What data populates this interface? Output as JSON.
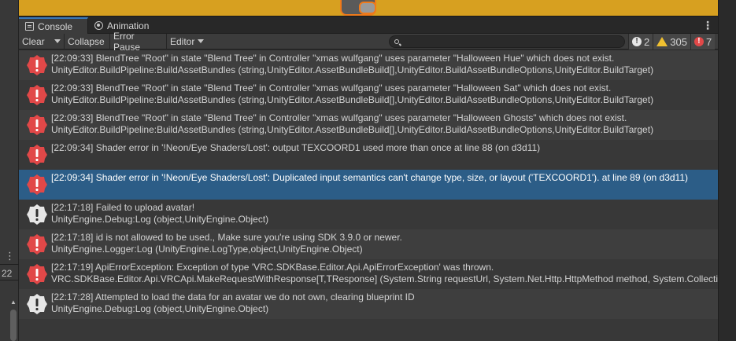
{
  "tabs": [
    {
      "label": "Console",
      "icon": "console-icon",
      "active": true
    },
    {
      "label": "Animation",
      "icon": "animation-icon",
      "active": false
    }
  ],
  "toolbar": {
    "clear_label": "Clear",
    "collapse_label": "Collapse",
    "error_pause_label": "Error Pause",
    "editor_label": "Editor",
    "search_placeholder": ""
  },
  "counts": {
    "info": "2",
    "warnings": "305",
    "errors": "7"
  },
  "left_panel": {
    "number": "22"
  },
  "colors": {
    "error": "#e14848",
    "warning": "#f0c030",
    "info": "#e6e6e6",
    "selection": "#2c5d87"
  },
  "logs": [
    {
      "type": "error",
      "line1": "[22:09:33] BlendTree \"Root\" in state \"Blend Tree\" in Controller \"xmas wulfgang\" uses parameter \"Halloween Hue\" which does not exist.",
      "line2": "UnityEditor.BuildPipeline:BuildAssetBundles (string,UnityEditor.AssetBundleBuild[],UnityEditor.BuildAssetBundleOptions,UnityEditor.BuildTarget)"
    },
    {
      "type": "error",
      "line1": "[22:09:33] BlendTree \"Root\" in state \"Blend Tree\" in Controller \"xmas wulfgang\" uses parameter \"Halloween Sat\" which does not exist.",
      "line2": "UnityEditor.BuildPipeline:BuildAssetBundles (string,UnityEditor.AssetBundleBuild[],UnityEditor.BuildAssetBundleOptions,UnityEditor.BuildTarget)"
    },
    {
      "type": "error",
      "line1": "[22:09:33] BlendTree \"Root\" in state \"Blend Tree\" in Controller \"xmas wulfgang\" uses parameter \"Halloween Ghosts\" which does not exist.",
      "line2": "UnityEditor.BuildPipeline:BuildAssetBundles (string,UnityEditor.AssetBundleBuild[],UnityEditor.BuildAssetBundleOptions,UnityEditor.BuildTarget)"
    },
    {
      "type": "error",
      "line1": "[22:09:34] Shader error in '!Neon/Eye Shaders/Lost': output TEXCOORD1 used more than once at line 88 (on d3d11)",
      "line2": ""
    },
    {
      "type": "error",
      "line1": "[22:09:34] Shader error in '!Neon/Eye Shaders/Lost': Duplicated input semantics can't change type, size, or layout ('TEXCOORD1'). at line 89 (on d3d11)",
      "line2": "",
      "selected": true
    },
    {
      "type": "info",
      "line1": "[22:17:18] Failed to upload avatar!",
      "line2": "UnityEngine.Debug:Log (object,UnityEngine.Object)"
    },
    {
      "type": "error",
      "line1": "[22:17:18] id is not allowed to be used., Make sure you're using SDK 3.9.0 or newer.",
      "line2": "UnityEngine.Logger:Log (UnityEngine.LogType,object,UnityEngine.Object)"
    },
    {
      "type": "error",
      "line1": "[22:17:19] ApiErrorException: Exception of type 'VRC.SDKBase.Editor.Api.ApiErrorException' was thrown.",
      "line2": "VRC.SDKBase.Editor.Api.VRCApi.MakeRequestWithResponse[T,TResponse] (System.String requestUrl, System.Net.Http.HttpMethod method, System.Collections"
    },
    {
      "type": "info",
      "line1": "[22:17:28] Attempted to load the data for an avatar we do not own, clearing blueprint ID",
      "line2": "UnityEngine.Debug:Log (object,UnityEngine.Object)"
    }
  ]
}
